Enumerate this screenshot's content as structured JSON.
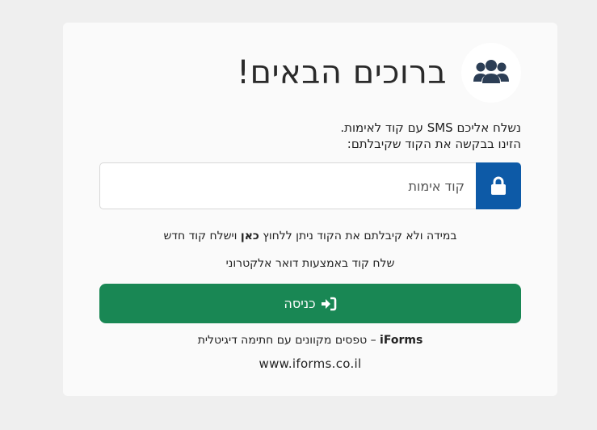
{
  "header": {
    "title": "ברוכים הבאים!",
    "icon": "users-icon"
  },
  "instructions": {
    "line1": "נשלח אליכם SMS עם קוד לאימות.",
    "line2": "הזינו בבקשה את הקוד שקיבלתם:"
  },
  "code_field": {
    "placeholder": "קוד אימות",
    "value": "",
    "icon": "lock-icon"
  },
  "resend": {
    "prefix": "במידה ולא קיבלתם את הקוד ניתן ללחוץ ",
    "link": "כאן",
    "suffix": " וישלח קוד חדש"
  },
  "email_option": "שלח קוד באמצעות דואר אלקטרוני",
  "login_button": {
    "label": "כניסה",
    "icon": "sign-in-icon"
  },
  "footer": {
    "brand": "iForms",
    "tagline": " – טפסים מקוונים עם חתימה דיגיטלית",
    "website": "www.iforms.co.il"
  },
  "colors": {
    "primary_blue": "#0d5aa7",
    "success_green": "#198754",
    "page_bg": "#efefef",
    "card_bg": "#fafafa"
  }
}
